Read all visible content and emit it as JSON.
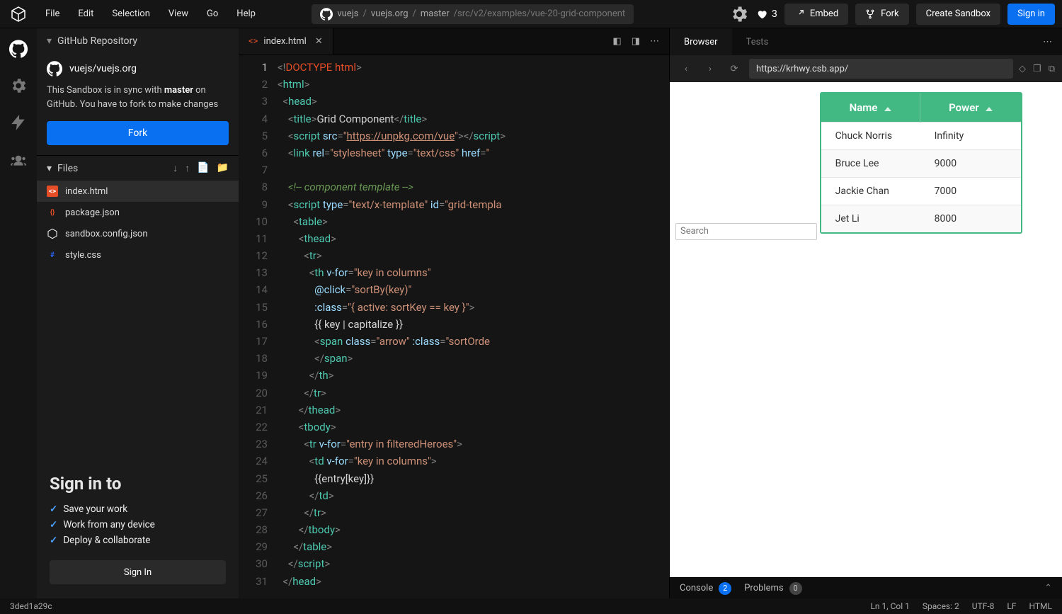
{
  "menu": {
    "file": "File",
    "edit": "Edit",
    "selection": "Selection",
    "view": "View",
    "go": "Go",
    "help": "Help"
  },
  "breadcrumb": {
    "owner": "vuejs",
    "repo": "vuejs.org",
    "branch": "master",
    "path": "/src/v2/examples/vue-20-grid-component"
  },
  "topbar": {
    "likes_count": "3",
    "embed": "Embed",
    "fork": "Fork",
    "create": "Create Sandbox",
    "signin": "Sign in"
  },
  "side": {
    "header": "GitHub Repository",
    "repo": "vuejs/vuejs.org",
    "sync_prefix": "This Sandbox is in sync with ",
    "sync_branch": "master",
    "sync_suffix": " on GitHub. You have to fork to make changes",
    "fork_btn": "Fork",
    "files_header": "Files",
    "files": [
      {
        "name": "index.html",
        "type": "html",
        "active": true
      },
      {
        "name": "package.json",
        "type": "json"
      },
      {
        "name": "sandbox.config.json",
        "type": "cfg"
      },
      {
        "name": "style.css",
        "type": "css"
      }
    ],
    "signin_title": "Sign in to",
    "features": [
      "Save your work",
      "Work from any device",
      "Deploy & collaborate"
    ],
    "signin_btn": "Sign In"
  },
  "editor": {
    "tab_label": "index.html",
    "url_text": "https://unpkg.com/vue"
  },
  "preview": {
    "tabs": {
      "browser": "Browser",
      "tests": "Tests"
    },
    "url": "https://krhwy.csb.app/",
    "search_placeholder": "Search",
    "columns": [
      "Name",
      "Power"
    ],
    "rows": [
      {
        "name": "Chuck Norris",
        "power": "Infinity"
      },
      {
        "name": "Bruce Lee",
        "power": "9000"
      },
      {
        "name": "Jackie Chan",
        "power": "7000"
      },
      {
        "name": "Jet Li",
        "power": "8000"
      }
    ],
    "console": "Console",
    "console_count": "2",
    "problems": "Problems",
    "problems_count": "0"
  },
  "status": {
    "commit": "3ded1a29c",
    "pos": "Ln 1, Col 1",
    "spaces": "Spaces: 2",
    "encoding": "UTF-8",
    "eol": "LF",
    "lang": "HTML"
  }
}
